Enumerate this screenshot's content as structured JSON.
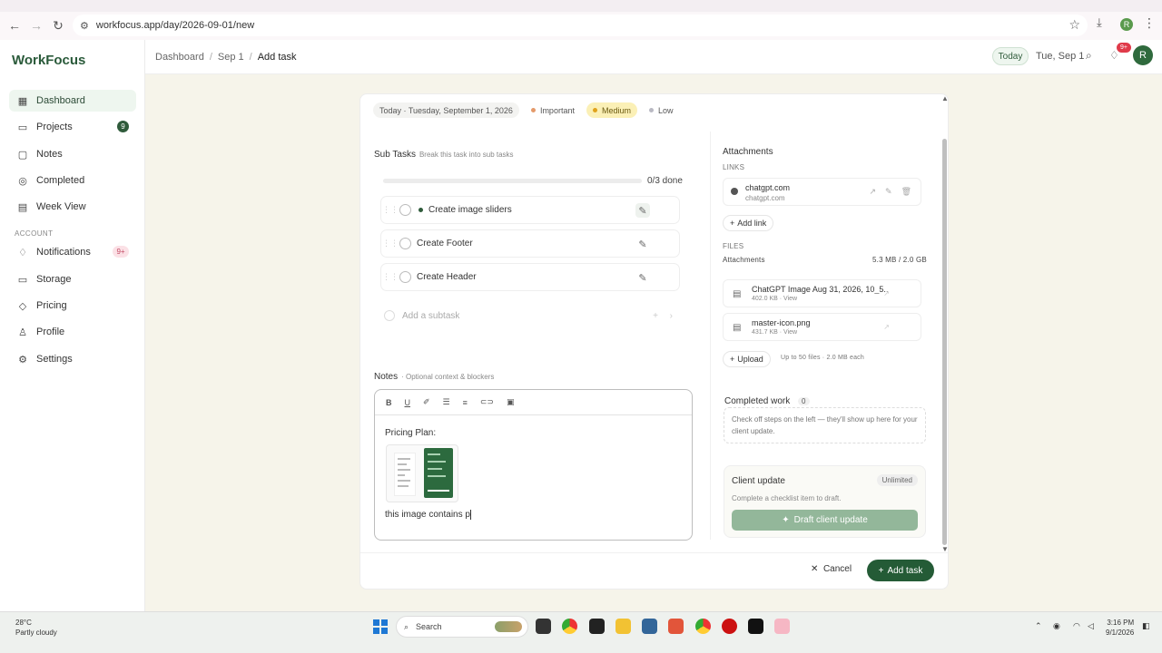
{
  "browser": {
    "url": "workfocus.app/day/2026-09-01/new",
    "profile_initial": "R"
  },
  "sidebar": {
    "brand": "WorkFocus",
    "items": [
      {
        "label": "Dashboard",
        "icon": "grid-icon",
        "active": true
      },
      {
        "label": "Projects",
        "icon": "folder-icon",
        "badge": "9"
      },
      {
        "label": "Notes",
        "icon": "note-icon"
      },
      {
        "label": "Completed",
        "icon": "check-circle-icon"
      },
      {
        "label": "Week View",
        "icon": "calendar-icon"
      }
    ],
    "section_account": "ACCOUNT",
    "account_items": [
      {
        "label": "Notifications",
        "icon": "bell-icon",
        "badge": "9+"
      },
      {
        "label": "Storage",
        "icon": "storage-icon"
      },
      {
        "label": "Pricing",
        "icon": "tag-icon"
      },
      {
        "label": "Profile",
        "icon": "user-icon"
      },
      {
        "label": "Settings",
        "icon": "gear-icon"
      }
    ]
  },
  "topbar": {
    "breadcrumb": [
      "Dashboard",
      "Sep 1",
      "Add task"
    ],
    "today_label": "Today",
    "date_label": "Tue, Sep 1",
    "notif_badge": "9+",
    "avatar_initial": "R"
  },
  "task": {
    "date_chip": "Today · Tuesday, September 1, 2026",
    "priorities": [
      {
        "label": "Important",
        "color": "#e49a6a"
      },
      {
        "label": "Medium",
        "color": "#e0a21b",
        "selected": true
      },
      {
        "label": "Low",
        "color": "#b9b9c3"
      }
    ],
    "subtasks_title": "Sub Tasks",
    "subtasks_hint": "Break this task into sub tasks",
    "progress_text": "0/3 done",
    "progress_fraction": 0,
    "subtasks": [
      "Create image sliders",
      "Create Footer",
      "Create Header"
    ],
    "add_subtask_placeholder": "Add a subtask",
    "notes_title": "Notes",
    "notes_hint": "· Optional context & blockers",
    "notes_heading": "Pricing Plan:",
    "notes_body": "this image contains p"
  },
  "attachments": {
    "title": "Attachments",
    "links_label": "LINKS",
    "link": {
      "title": "chatgpt.com",
      "sub": "chatgpt.com"
    },
    "add_link": "Add link",
    "files_label": "FILES",
    "files_title": "Attachments",
    "storage": "5.3 MB / 2.0 GB",
    "files": [
      {
        "name": "ChatGPT Image Aug 31, 2026, 10_5...",
        "meta": "402.0 KB · View"
      },
      {
        "name": "master-icon.png",
        "meta": "431.7 KB · View"
      }
    ],
    "upload": "Upload",
    "upload_hint": "Up to 50 files · 2.0 MB each",
    "completed_title": "Completed work",
    "completed_count": "0",
    "completed_hint": "Check off steps on the left — they'll show up here for your client update.",
    "client_update_title": "Client update",
    "client_update_tag": "Unlimited",
    "client_update_desc": "Complete a checklist item to draft.",
    "draft_button": "Draft client update"
  },
  "footer": {
    "cancel": "Cancel",
    "add_task": "Add task"
  },
  "taskbar": {
    "temp": "28°C",
    "weather": "Partly cloudy",
    "search": "Search",
    "time": "3:16 PM",
    "date": "9/1/2026"
  }
}
